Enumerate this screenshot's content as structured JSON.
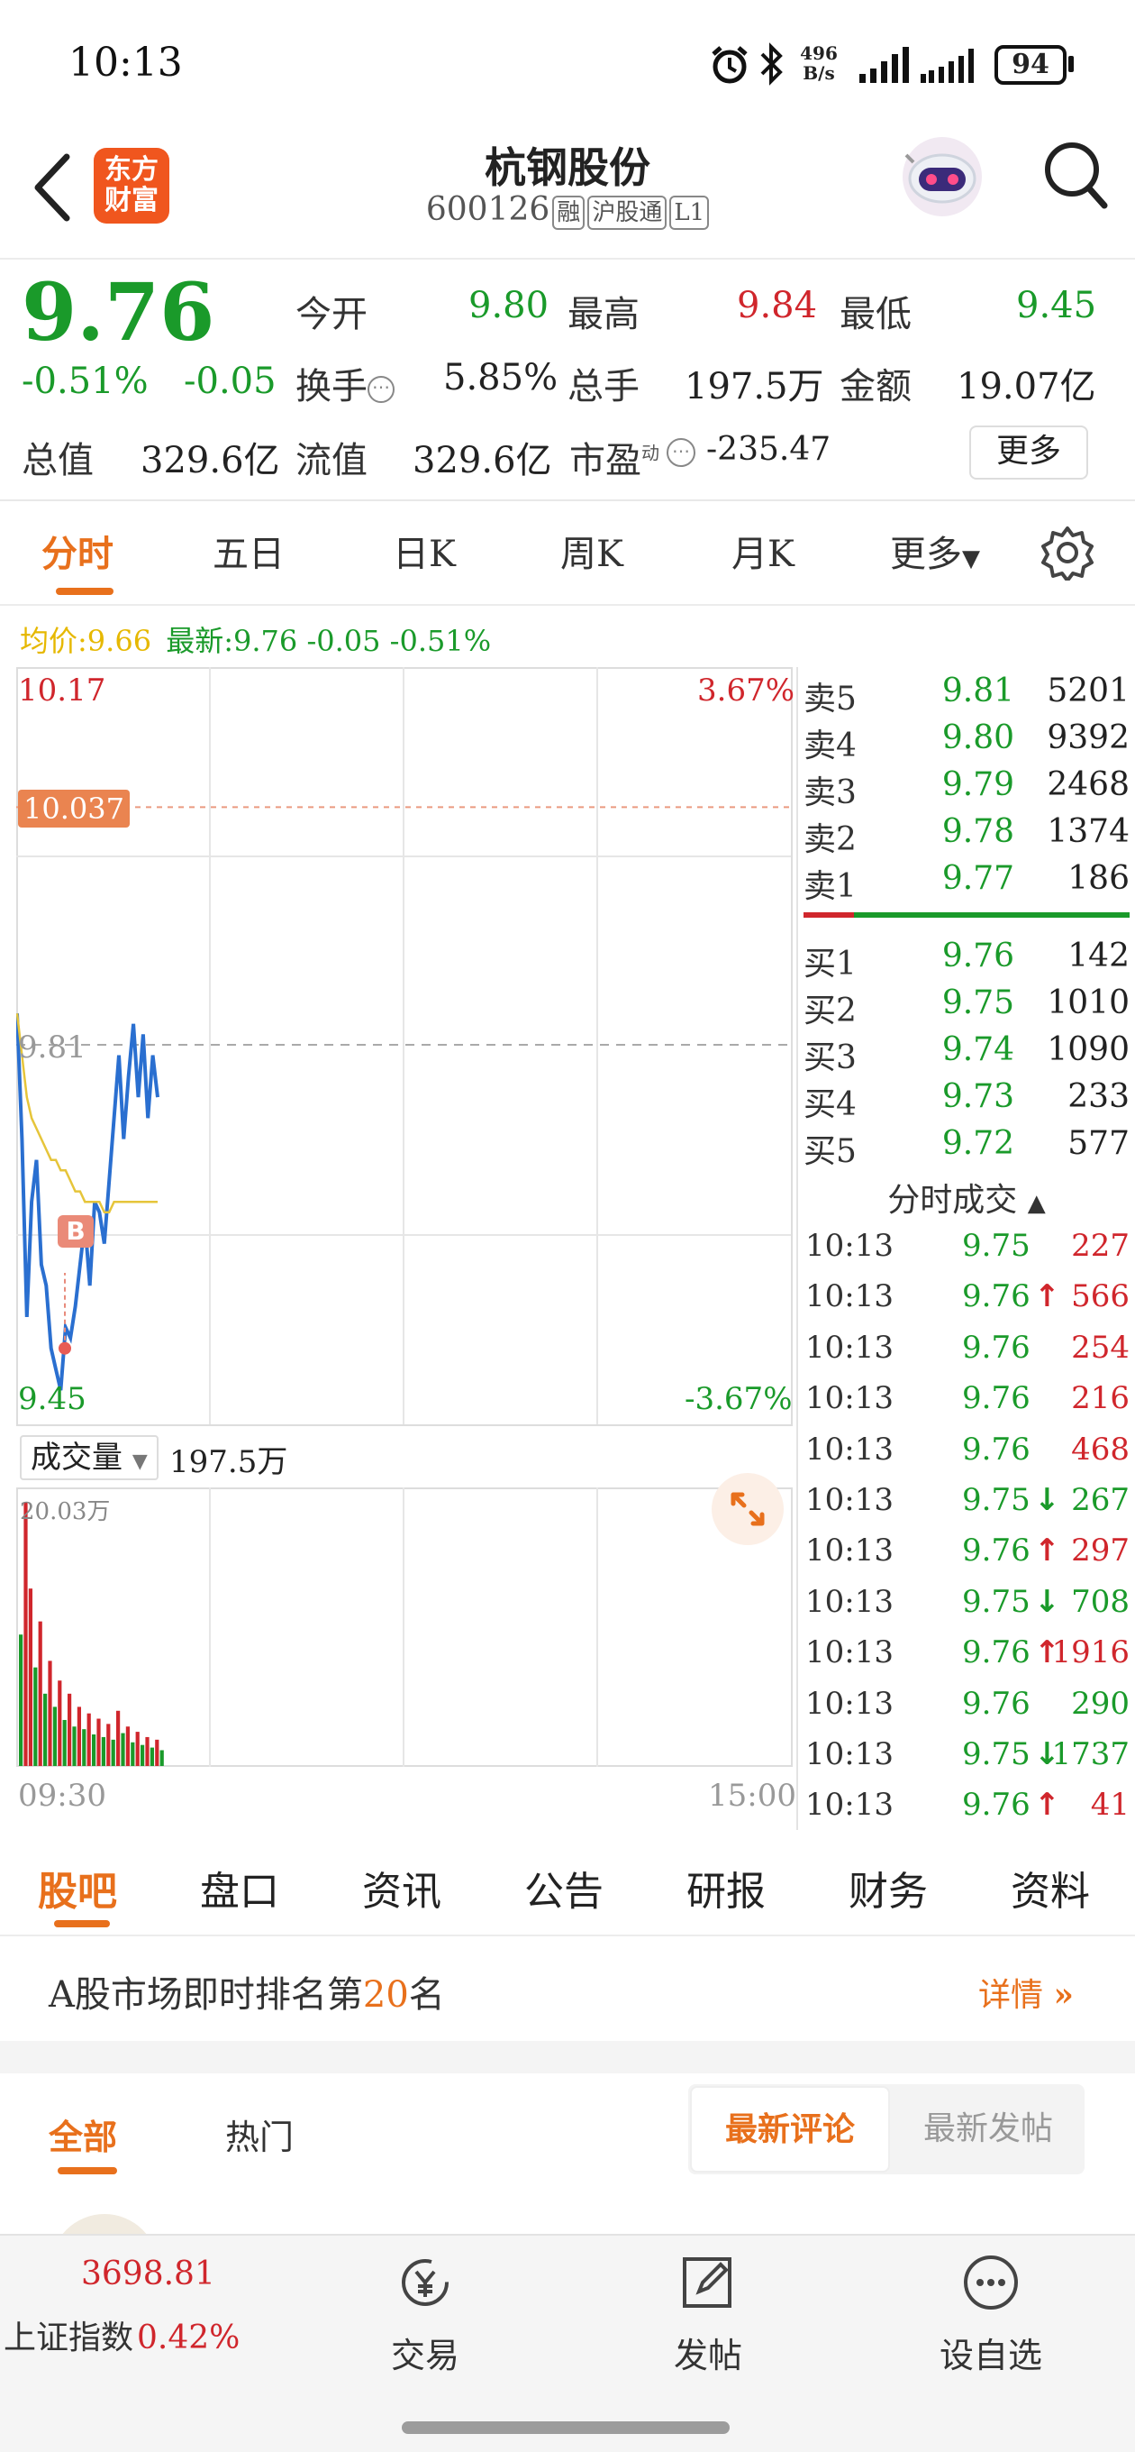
{
  "status": {
    "time": "10:13",
    "net_speed_top": "496",
    "net_speed_unit": "B/s",
    "battery": "94"
  },
  "header": {
    "logo_line1": "东方",
    "logo_line2": "财富",
    "stock_name": "杭钢股份",
    "stock_code": "600126",
    "tags": [
      "融",
      "沪股通",
      "L1"
    ]
  },
  "quote": {
    "price": "9.76",
    "change_pct": "-0.51%",
    "change": "-0.05",
    "open_label": "今开",
    "open": "9.80",
    "high_label": "最高",
    "high": "9.84",
    "low_label": "最低",
    "low": "9.45",
    "turnover_label": "换手",
    "turnover": "5.85%",
    "volume_label": "总手",
    "volume": "197.5万",
    "amount_label": "金额",
    "amount": "19.07亿",
    "total_value_label": "总值",
    "total_value": "329.6亿",
    "float_value_label": "流值",
    "float_value": "329.6亿",
    "pe_label": "市盈",
    "pe_sup": "动",
    "pe": "-235.47",
    "more_button": "更多"
  },
  "period_tabs": [
    "分时",
    "五日",
    "日K",
    "周K",
    "月K",
    "更多"
  ],
  "info_line": {
    "avg_label": "均价:",
    "avg": "9.66",
    "latest_label": "最新:",
    "latest": "9.76 -0.05 -0.51%"
  },
  "chart": {
    "y_top": "10.17",
    "pct_top": "3.67%",
    "marker": "10.037",
    "prev_close": "9.81",
    "y_bottom": "9.45",
    "pct_bottom": "-3.67%",
    "buy_marker": "B",
    "volume_selector": "成交量",
    "volume_value": "197.5万",
    "volume_max": "20.03万",
    "time_start": "09:30",
    "time_end": "15:00"
  },
  "chart_data": {
    "type": "line",
    "ylim": [
      9.45,
      10.17
    ],
    "prev_close": 9.81,
    "series": [
      {
        "name": "最新",
        "values": [
          9.84,
          9.72,
          9.55,
          9.66,
          9.7,
          9.6,
          9.58,
          9.52,
          9.5,
          9.48,
          9.54,
          9.53,
          9.56,
          9.6,
          9.64,
          9.58,
          9.66,
          9.65,
          9.62,
          9.68,
          9.74,
          9.8,
          9.72,
          9.78,
          9.83,
          9.76,
          9.82,
          9.74,
          9.8,
          9.76
        ]
      },
      {
        "name": "均价",
        "values": [
          9.84,
          9.8,
          9.76,
          9.74,
          9.73,
          9.72,
          9.71,
          9.7,
          9.7,
          9.69,
          9.69,
          9.68,
          9.67,
          9.67,
          9.66,
          9.66,
          9.66,
          9.66,
          9.65,
          9.65,
          9.66,
          9.66,
          9.66,
          9.66,
          9.66,
          9.66,
          9.66,
          9.66,
          9.66,
          9.66
        ]
      }
    ],
    "volume": [
      {
        "v": 10.0,
        "up": false
      },
      {
        "v": 20.03,
        "up": true
      },
      {
        "v": 13.5,
        "up": true
      },
      {
        "v": 7.5,
        "up": false
      },
      {
        "v": 11.0,
        "up": true
      },
      {
        "v": 5.5,
        "up": false
      },
      {
        "v": 8.0,
        "up": true
      },
      {
        "v": 4.5,
        "up": false
      },
      {
        "v": 6.5,
        "up": true
      },
      {
        "v": 3.5,
        "up": false
      },
      {
        "v": 5.5,
        "up": true
      },
      {
        "v": 3.0,
        "up": false
      },
      {
        "v": 4.5,
        "up": true
      },
      {
        "v": 2.8,
        "up": false
      },
      {
        "v": 4.0,
        "up": true
      },
      {
        "v": 2.4,
        "up": false
      },
      {
        "v": 3.6,
        "up": true
      },
      {
        "v": 2.2,
        "up": false
      },
      {
        "v": 3.2,
        "up": true
      },
      {
        "v": 2.0,
        "up": false
      },
      {
        "v": 4.2,
        "up": true
      },
      {
        "v": 2.5,
        "up": false
      },
      {
        "v": 3.0,
        "up": true
      },
      {
        "v": 1.8,
        "up": false
      },
      {
        "v": 2.6,
        "up": true
      },
      {
        "v": 1.6,
        "up": false
      },
      {
        "v": 2.2,
        "up": true
      },
      {
        "v": 1.4,
        "up": false
      },
      {
        "v": 2.0,
        "up": true
      },
      {
        "v": 1.2,
        "up": false
      }
    ]
  },
  "order_book": {
    "asks": [
      {
        "label": "卖5",
        "price": "9.81",
        "vol": "5201"
      },
      {
        "label": "卖4",
        "price": "9.80",
        "vol": "9392"
      },
      {
        "label": "卖3",
        "price": "9.79",
        "vol": "2468"
      },
      {
        "label": "卖2",
        "price": "9.78",
        "vol": "1374"
      },
      {
        "label": "卖1",
        "price": "9.77",
        "vol": "186"
      }
    ],
    "bids": [
      {
        "label": "买1",
        "price": "9.76",
        "vol": "142"
      },
      {
        "label": "买2",
        "price": "9.75",
        "vol": "1010"
      },
      {
        "label": "买3",
        "price": "9.74",
        "vol": "1090"
      },
      {
        "label": "买4",
        "price": "9.73",
        "vol": "233"
      },
      {
        "label": "买5",
        "price": "9.72",
        "vol": "577"
      }
    ]
  },
  "trades": {
    "title": "分时成交",
    "rows": [
      {
        "time": "10:13",
        "price": "9.75",
        "arrow": "",
        "vol": "227",
        "vol_color": "red"
      },
      {
        "time": "10:13",
        "price": "9.76",
        "arrow": "↑",
        "vol": "566",
        "vol_color": "red"
      },
      {
        "time": "10:13",
        "price": "9.76",
        "arrow": "",
        "vol": "254",
        "vol_color": "red"
      },
      {
        "time": "10:13",
        "price": "9.76",
        "arrow": "",
        "vol": "216",
        "vol_color": "red"
      },
      {
        "time": "10:13",
        "price": "9.76",
        "arrow": "",
        "vol": "468",
        "vol_color": "red"
      },
      {
        "time": "10:13",
        "price": "9.75",
        "arrow": "↓",
        "vol": "267",
        "vol_color": "green"
      },
      {
        "time": "10:13",
        "price": "9.76",
        "arrow": "↑",
        "vol": "297",
        "vol_color": "red"
      },
      {
        "time": "10:13",
        "price": "9.75",
        "arrow": "↓",
        "vol": "708",
        "vol_color": "green"
      },
      {
        "time": "10:13",
        "price": "9.76",
        "arrow": "↑",
        "vol": "1916",
        "vol_color": "red"
      },
      {
        "time": "10:13",
        "price": "9.76",
        "arrow": "",
        "vol": "290",
        "vol_color": "green"
      },
      {
        "time": "10:13",
        "price": "9.75",
        "arrow": "↓",
        "vol": "1737",
        "vol_color": "green"
      },
      {
        "time": "10:13",
        "price": "9.76",
        "arrow": "↑",
        "vol": "41",
        "vol_color": "red"
      }
    ]
  },
  "categories": [
    "股吧",
    "盘口",
    "资讯",
    "公告",
    "研报",
    "财务",
    "资料"
  ],
  "ranking": {
    "prefix": "A股市场即时排名第",
    "rank": "20",
    "suffix": "名",
    "detail": "详情"
  },
  "feed": {
    "tabs": [
      "全部",
      "热门"
    ],
    "sort_active": "最新评论",
    "sort_other": "最新发帖"
  },
  "bottom": {
    "index_value": "3698.81",
    "index_name": "上证指数",
    "index_change": "0.42%",
    "nav": [
      "交易",
      "发帖",
      "设自选"
    ]
  },
  "colors": {
    "accent": "#e8701c",
    "up": "#d0262c",
    "down": "#1a9a2a",
    "line": "#2a6fd0",
    "avg": "#e6c53a"
  }
}
